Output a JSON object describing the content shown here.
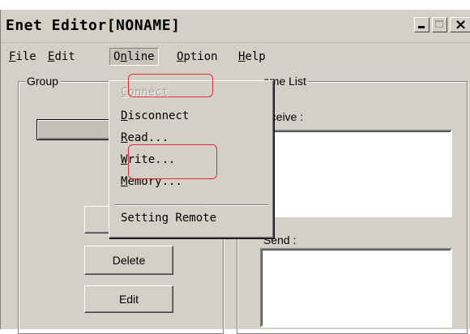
{
  "window": {
    "title": "Enet Editor[NONAME]",
    "close_glyph": "×"
  },
  "menubar": {
    "file": {
      "accel": "F",
      "rest": "ile"
    },
    "edit": {
      "accel": "E",
      "rest": "dit"
    },
    "online": {
      "pre": "O",
      "accel": "n",
      "rest": "line"
    },
    "option": {
      "accel": "O",
      "rest": "ption"
    },
    "help": {
      "accel": "H",
      "rest": "elp"
    }
  },
  "online_menu": {
    "connect": {
      "accel": "C",
      "rest": "onnect",
      "enabled": false
    },
    "disconnect": {
      "accel": "D",
      "rest": "isconnect"
    },
    "read": {
      "accel": "R",
      "rest": "ead..."
    },
    "write": {
      "accel": "W",
      "rest": "rite..."
    },
    "memory": {
      "accel": "M",
      "rest": "emory..."
    },
    "setting_remote": {
      "label": "Setting Remote"
    }
  },
  "group": {
    "label": "Group",
    "delete_label": "Delete",
    "edit_label": "Edit"
  },
  "frame_list": {
    "label_visible": "ame List",
    "receive_label_visible": "eceive :",
    "send_label": "Send :"
  },
  "colors": {
    "highlight_annotation": "#e8293a",
    "window_face": "#d4d0c8"
  }
}
